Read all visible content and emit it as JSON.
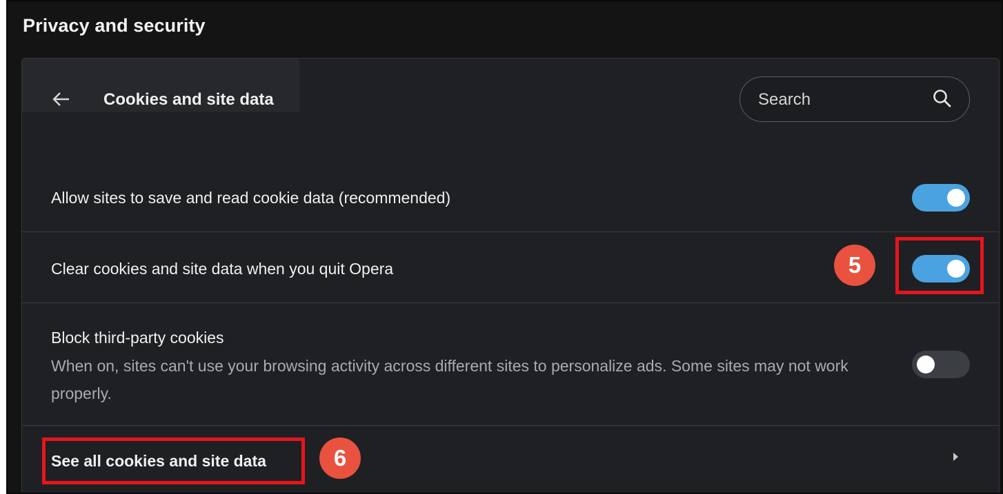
{
  "section": {
    "title": "Privacy and security"
  },
  "header": {
    "title": "Cookies and site data",
    "back_icon": "arrow-left-icon"
  },
  "search": {
    "placeholder": "Search",
    "value": "",
    "icon": "search-icon"
  },
  "settings": [
    {
      "label": "Allow sites to save and read cookie data (recommended)",
      "enabled": true
    },
    {
      "label": "Clear cookies and site data when you quit Opera",
      "enabled": true
    },
    {
      "label": "Block third-party cookies",
      "description": "When on, sites can't use your browsing activity across different sites to personalize ads. Some sites may not work properly.",
      "enabled": false
    }
  ],
  "link_row": {
    "label": "See all cookies and site data",
    "icon": "chevron-right-icon"
  },
  "annotations": [
    {
      "number": "5",
      "color": "#e8523e"
    },
    {
      "number": "6",
      "color": "#e8523e"
    }
  ],
  "colors": {
    "accent_toggle_on": "#4aa3e0",
    "toggle_off": "#3b3e43",
    "highlight_box": "#e8141b",
    "background": "#141414",
    "card": "#1e2024"
  }
}
